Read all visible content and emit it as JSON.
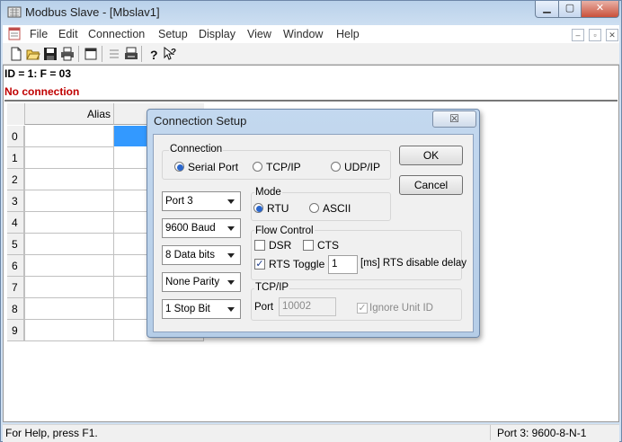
{
  "window": {
    "title": "Modbus Slave - [Mbslav1]"
  },
  "menu": [
    "File",
    "Edit",
    "Connection",
    "Setup",
    "Display",
    "View",
    "Window",
    "Help"
  ],
  "document": {
    "info": "ID = 1: F = 03",
    "status": "No connection",
    "grid": {
      "column_header": "Alias",
      "row_numbers": [
        "0",
        "1",
        "2",
        "3",
        "4",
        "5",
        "6",
        "7",
        "8",
        "9"
      ]
    }
  },
  "statusbar": {
    "help": "For Help, press F1.",
    "port": "Port 3: 9600-8-N-1"
  },
  "dialog": {
    "title": "Connection Setup",
    "close_glyph": "☒",
    "connection": {
      "label": "Connection",
      "options": [
        "Serial Port",
        "TCP/IP",
        "UDP/IP"
      ],
      "selected": "Serial Port"
    },
    "ok_label": "OK",
    "cancel_label": "Cancel",
    "serial": {
      "port": "Port 3",
      "baud": "9600 Baud",
      "data_bits": "8 Data bits",
      "parity": "None Parity",
      "stop_bits": "1 Stop Bit"
    },
    "mode": {
      "label": "Mode",
      "options": [
        "RTU",
        "ASCII"
      ],
      "selected": "RTU"
    },
    "flow_control": {
      "label": "Flow Control",
      "dsr": {
        "label": "DSR",
        "checked": false
      },
      "cts": {
        "label": "CTS",
        "checked": false
      },
      "rts_toggle": {
        "label": "RTS Toggle",
        "checked": true
      },
      "rts_delay_value": "1",
      "rts_delay_unit": "[ms] RTS disable delay"
    },
    "tcpip": {
      "label": "TCP/IP",
      "port_label": "Port",
      "port_value": "10002",
      "ignore_unit_id": {
        "label": "Ignore Unit ID",
        "checked": true
      }
    }
  },
  "colors": {
    "error_text": "#c00000",
    "selection": "#3399ff"
  }
}
